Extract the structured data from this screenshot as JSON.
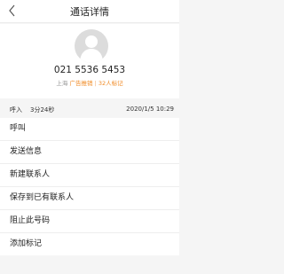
{
  "header": {
    "title": "通话详情",
    "back_icon": "chevron-left-icon"
  },
  "contact": {
    "avatar_icon": "person-placeholder-icon",
    "number": "021 5536 5453",
    "location": "上海",
    "tag": "广告推销",
    "separator": "|",
    "marked_count": "32人标记"
  },
  "call_log": {
    "type": "呼入",
    "duration": "3分24秒",
    "time": "2020/1/5 10:29"
  },
  "actions": [
    "呼叫",
    "发送信息",
    "新建联系人",
    "保存到已有联系人",
    "阻止此号码",
    "添加标记"
  ],
  "colors": {
    "accent": "#f08a24",
    "background": "#f5f5f5",
    "avatar": "#dcdcdc"
  }
}
